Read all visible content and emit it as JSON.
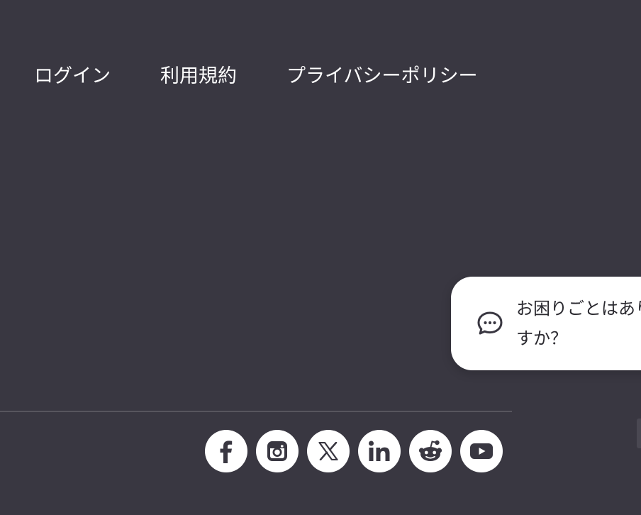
{
  "footer": {
    "links": [
      {
        "label": "ログイン"
      },
      {
        "label": "利用規約"
      },
      {
        "label": "プライバシーポリシー"
      }
    ]
  },
  "help_widget": {
    "icon": "chat-bubble-icon",
    "text": "お困りごとはありますか？"
  },
  "social": {
    "icons": [
      "facebook-icon",
      "instagram-icon",
      "x-icon",
      "linkedin-icon",
      "reddit-icon",
      "youtube-icon"
    ]
  },
  "colors": {
    "background": "#393741",
    "icon_dark": "#393741",
    "text_light": "#ffffff"
  }
}
